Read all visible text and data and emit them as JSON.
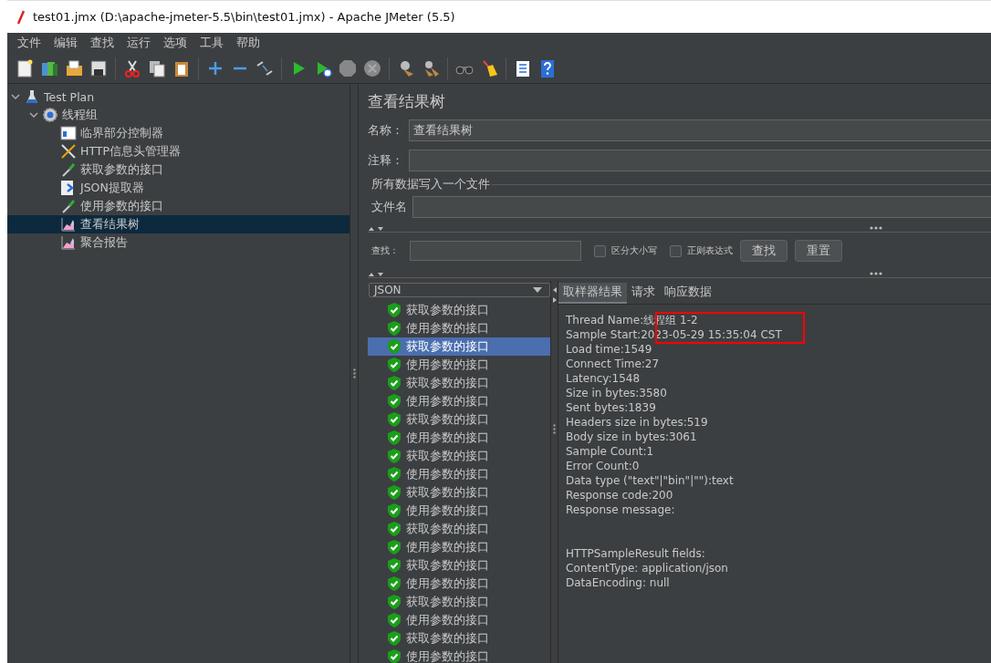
{
  "window": {
    "title": "test01.jmx (D:\\apache-jmeter-5.5\\bin\\test01.jmx) - Apache JMeter (5.5)"
  },
  "menu": [
    "文件",
    "编辑",
    "查找",
    "运行",
    "选项",
    "工具",
    "帮助"
  ],
  "tree": [
    {
      "label": "Test Plan",
      "kind": "plan",
      "expanded": true,
      "selected": false,
      "children": [
        {
          "label": "线程组",
          "kind": "threadgroup",
          "expanded": true,
          "selected": false,
          "children": [
            {
              "label": "临界部分控制器",
              "kind": "controller",
              "selected": false
            },
            {
              "label": "HTTP信息头管理器",
              "kind": "config",
              "selected": false
            },
            {
              "label": "获取参数的接口",
              "kind": "sampler",
              "selected": false
            },
            {
              "label": "JSON提取器",
              "kind": "extractor",
              "selected": false
            },
            {
              "label": "使用参数的接口",
              "kind": "sampler",
              "selected": false
            },
            {
              "label": "查看结果树",
              "kind": "listener",
              "selected": true
            },
            {
              "label": "聚合报告",
              "kind": "listener",
              "selected": false
            }
          ]
        }
      ]
    }
  ],
  "panel": {
    "title": "查看结果树",
    "name_label": "名称：",
    "name_value": "查看结果树",
    "comment_label": "注释：",
    "file_group": "所有数据写入一个文件",
    "file_label": "文件名",
    "search_label": "查找：",
    "case_label": "区分大小写",
    "case_checked": false,
    "regex_label": "正则表达式",
    "regex_checked": false,
    "search_button": "查找",
    "reset_button": "重置"
  },
  "renderer": {
    "value": "JSON"
  },
  "results": [
    {
      "label": "获取参数的接口",
      "selected": false
    },
    {
      "label": "使用参数的接口",
      "selected": false
    },
    {
      "label": "获取参数的接口",
      "selected": true
    },
    {
      "label": "使用参数的接口",
      "selected": false
    },
    {
      "label": "获取参数的接口",
      "selected": false
    },
    {
      "label": "使用参数的接口",
      "selected": false
    },
    {
      "label": "获取参数的接口",
      "selected": false
    },
    {
      "label": "使用参数的接口",
      "selected": false
    },
    {
      "label": "获取参数的接口",
      "selected": false
    },
    {
      "label": "使用参数的接口",
      "selected": false
    },
    {
      "label": "获取参数的接口",
      "selected": false
    },
    {
      "label": "使用参数的接口",
      "selected": false
    },
    {
      "label": "获取参数的接口",
      "selected": false
    },
    {
      "label": "使用参数的接口",
      "selected": false
    },
    {
      "label": "获取参数的接口",
      "selected": false
    },
    {
      "label": "使用参数的接口",
      "selected": false
    },
    {
      "label": "获取参数的接口",
      "selected": false
    },
    {
      "label": "使用参数的接口",
      "selected": false
    },
    {
      "label": "获取参数的接口",
      "selected": false
    },
    {
      "label": "使用参数的接口",
      "selected": false
    }
  ],
  "detail_tabs": [
    {
      "label": "取样器结果",
      "selected": true
    },
    {
      "label": "请求",
      "selected": false
    },
    {
      "label": "响应数据",
      "selected": false
    }
  ],
  "sampler_result": [
    "Thread Name:线程组 1-2",
    "Sample Start:2023-05-29 15:35:04 CST",
    "Load time:1549",
    "Connect Time:27",
    "Latency:1548",
    "Size in bytes:3580",
    "Sent bytes:1839",
    "Headers size in bytes:519",
    "Body size in bytes:3061",
    "Sample Count:1",
    "Error Count:0",
    "Data type (\"text\"|\"bin\"|\"\"):text",
    "Response code:200",
    "Response message:"
  ],
  "http_fields": [
    "HTTPSampleResult fields:",
    "ContentType: application/json",
    "DataEncoding: null"
  ]
}
